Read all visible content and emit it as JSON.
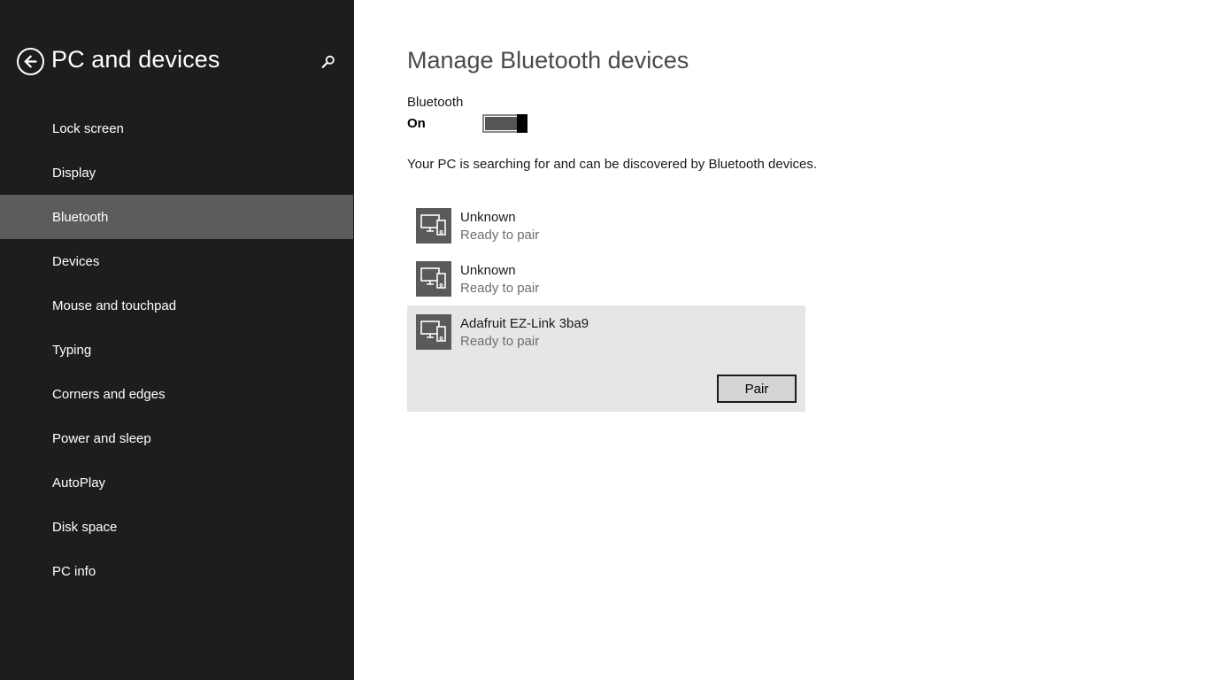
{
  "sidebar": {
    "title": "PC and devices",
    "back_icon": "back-arrow-icon",
    "search_icon": "search-icon",
    "items": [
      {
        "label": "Lock screen"
      },
      {
        "label": "Display"
      },
      {
        "label": "Bluetooth",
        "selected": true
      },
      {
        "label": "Devices"
      },
      {
        "label": "Mouse and touchpad"
      },
      {
        "label": "Typing"
      },
      {
        "label": "Corners and edges"
      },
      {
        "label": "Power and sleep"
      },
      {
        "label": "AutoPlay"
      },
      {
        "label": "Disk space"
      },
      {
        "label": "PC info"
      }
    ]
  },
  "main": {
    "title": "Manage Bluetooth devices",
    "bluetooth": {
      "label": "Bluetooth",
      "state": "On"
    },
    "status_text": "Your PC is searching for and can be discovered by Bluetooth devices.",
    "devices": [
      {
        "name": "Unknown",
        "status": "Ready to pair",
        "icon": "device-pair-icon"
      },
      {
        "name": "Unknown",
        "status": "Ready to pair",
        "icon": "device-pair-icon"
      },
      {
        "name": "Adafruit EZ-Link 3ba9",
        "status": "Ready to pair",
        "icon": "device-pair-icon",
        "selected": true
      }
    ],
    "pair_label": "Pair"
  },
  "colors": {
    "sidebar_bg": "#1d1d1d",
    "sidebar_selected": "#5c5c5c",
    "main_bg": "#ffffff",
    "selected_device_bg": "#e6e6e6",
    "device_icon_bg": "#5a5a5a"
  }
}
